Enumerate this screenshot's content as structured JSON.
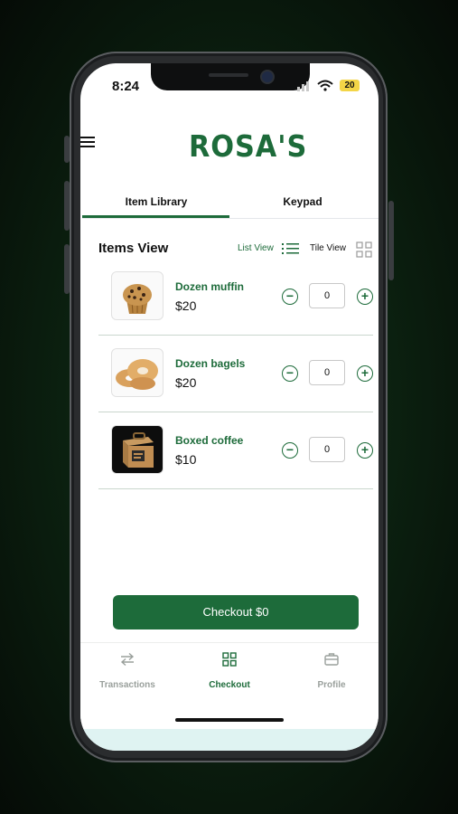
{
  "status_bar": {
    "time": "8:24",
    "battery": "20"
  },
  "header": {
    "logo": "ROSA'S"
  },
  "tabs": [
    {
      "label": "Item Library",
      "active": true
    },
    {
      "label": "Keypad",
      "active": false
    }
  ],
  "items_view": {
    "title": "Items View",
    "list_view_label": "List View",
    "tile_view_label": "Tile View"
  },
  "items": [
    {
      "name": "Dozen muffin",
      "price": "$20",
      "qty": "0",
      "icon": "muffin-image"
    },
    {
      "name": "Dozen bagels",
      "price": "$20",
      "qty": "0",
      "icon": "bagels-image"
    },
    {
      "name": "Boxed coffee",
      "price": "$10",
      "qty": "0",
      "icon": "coffee-box-image"
    }
  ],
  "checkout": {
    "label": "Checkout $0"
  },
  "bottom_nav": [
    {
      "label": "Transactions",
      "icon": "transfer-arrows-icon",
      "active": false
    },
    {
      "label": "Checkout",
      "icon": "grid-icon",
      "active": true
    },
    {
      "label": "Profile",
      "icon": "briefcase-icon",
      "active": false
    }
  ],
  "colors": {
    "brand": "#1d6b3a",
    "background": "#0c2311"
  }
}
